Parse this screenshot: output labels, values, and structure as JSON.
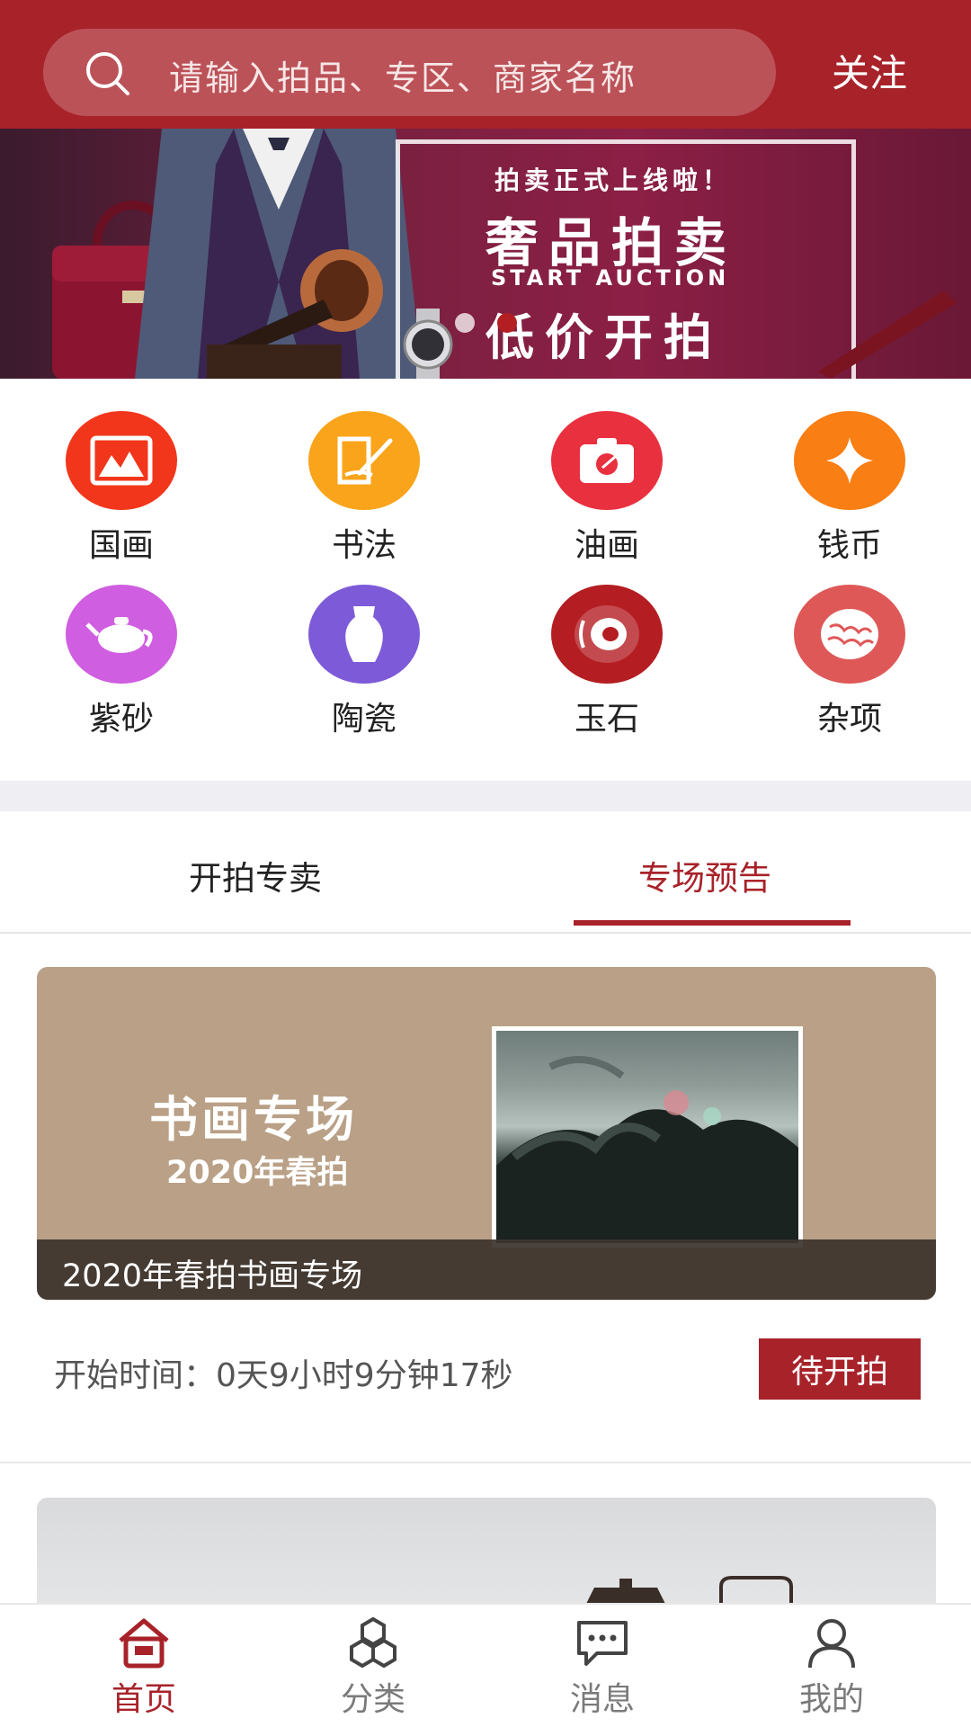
{
  "header": {
    "search_placeholder": "请输入拍品、专区、商家名称",
    "follow_label": "关注"
  },
  "banner": {
    "kicker": "拍卖正式上线啦！",
    "title": "奢品拍卖",
    "subtitle": "START AUCTION",
    "title2": "低价开拍",
    "active_slide": 2,
    "slide_count": 2
  },
  "categories": [
    {
      "label": "国画",
      "icon": "landscape-painting-icon",
      "color": "#f2361b"
    },
    {
      "label": "书法",
      "icon": "brush-calligraphy-icon",
      "color": "#f9a41a"
    },
    {
      "label": "油画",
      "icon": "palette-icon",
      "color": "#e9303f"
    },
    {
      "label": "钱币",
      "icon": "coin-icon",
      "color": "#f97e13"
    },
    {
      "label": "紫砂",
      "icon": "teapot-icon",
      "color": "#cf5ee0"
    },
    {
      "label": "陶瓷",
      "icon": "vase-icon",
      "color": "#7d5ad8"
    },
    {
      "label": "玉石",
      "icon": "jade-bi-icon",
      "color": "#b41d22"
    },
    {
      "label": "杂项",
      "icon": "walnut-icon",
      "color": "#df5858"
    }
  ],
  "tabs": {
    "items": [
      "开拍专卖",
      "专场预告"
    ],
    "active": 1
  },
  "session": {
    "card_title": "书画专场",
    "card_subtitle": "2020年春拍",
    "caption": "2020年春拍书画专场",
    "start_time": "开始时间：0天9小时9分钟17秒",
    "status": "待开拍"
  },
  "bottom_nav": {
    "items": [
      {
        "label": "首页",
        "icon": "home-icon",
        "active": true
      },
      {
        "label": "分类",
        "icon": "category-icon",
        "active": false
      },
      {
        "label": "消息",
        "icon": "message-icon",
        "active": false
      },
      {
        "label": "我的",
        "icon": "profile-icon",
        "active": false
      }
    ]
  },
  "colors": {
    "brand": "#a8222a",
    "separator": "#efeff3"
  }
}
